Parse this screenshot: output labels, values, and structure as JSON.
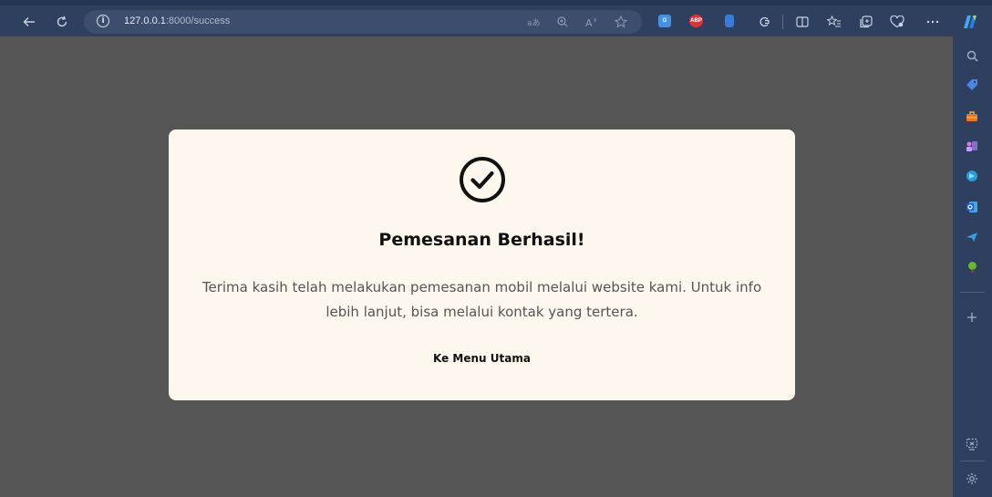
{
  "browser": {
    "url_host": "127.0.0.1",
    "url_path": ":8000/success",
    "toolbar_icons": [
      "back-icon",
      "refresh-icon",
      "info-icon",
      "translate-icon",
      "zoom-icon",
      "read-aloud-icon",
      "favorite-star-icon",
      "extensions",
      "split-screen-icon",
      "favorites-icon",
      "collections-icon",
      "performance-icon",
      "more-icon",
      "copilot-icon"
    ],
    "extensions": [
      {
        "name": "translate-extension",
        "color": "#4a90e2",
        "label": "G"
      },
      {
        "name": "adblock-plus-extension",
        "color": "#d9343a",
        "label": "ABP"
      },
      {
        "name": "docs-extension",
        "color": "#3a7bd5",
        "label": ""
      },
      {
        "name": "puzzle-extension",
        "color": "#2f3f5f",
        "label": ""
      }
    ]
  },
  "page": {
    "title": "Pemesanan Berhasil!",
    "message": "Terima kasih telah melakukan pemesanan mobil melalui website kami. Untuk info lebih lanjut, bisa melalui kontak yang tertera.",
    "link_label": "Ke Menu Utama",
    "icon": "check-circle-icon"
  },
  "sidebar": {
    "icons": [
      {
        "name": "search-icon",
        "color": "#9fb0d0"
      },
      {
        "name": "tag-icon",
        "color": "#4a86e8"
      },
      {
        "name": "briefcase-icon",
        "color": "#e8762b"
      },
      {
        "name": "games-icon",
        "color": "#8a6ccf"
      },
      {
        "name": "copilot-sidebar-icon",
        "color": "#2d9cdb"
      },
      {
        "name": "outlook-icon",
        "color": "#2f7bd6"
      },
      {
        "name": "send-icon",
        "color": "#3aa0e8"
      },
      {
        "name": "tree-icon",
        "color": "#67b437"
      },
      {
        "name": "add-icon",
        "color": "#9fb0d0"
      },
      {
        "name": "screenshot-icon",
        "color": "#9fb0d0"
      },
      {
        "name": "settings-icon",
        "color": "#9fb0d0"
      }
    ]
  },
  "colors": {
    "toolbar": "#2f3f5f",
    "viewport": "#555555",
    "card": "#fdf7ee"
  }
}
